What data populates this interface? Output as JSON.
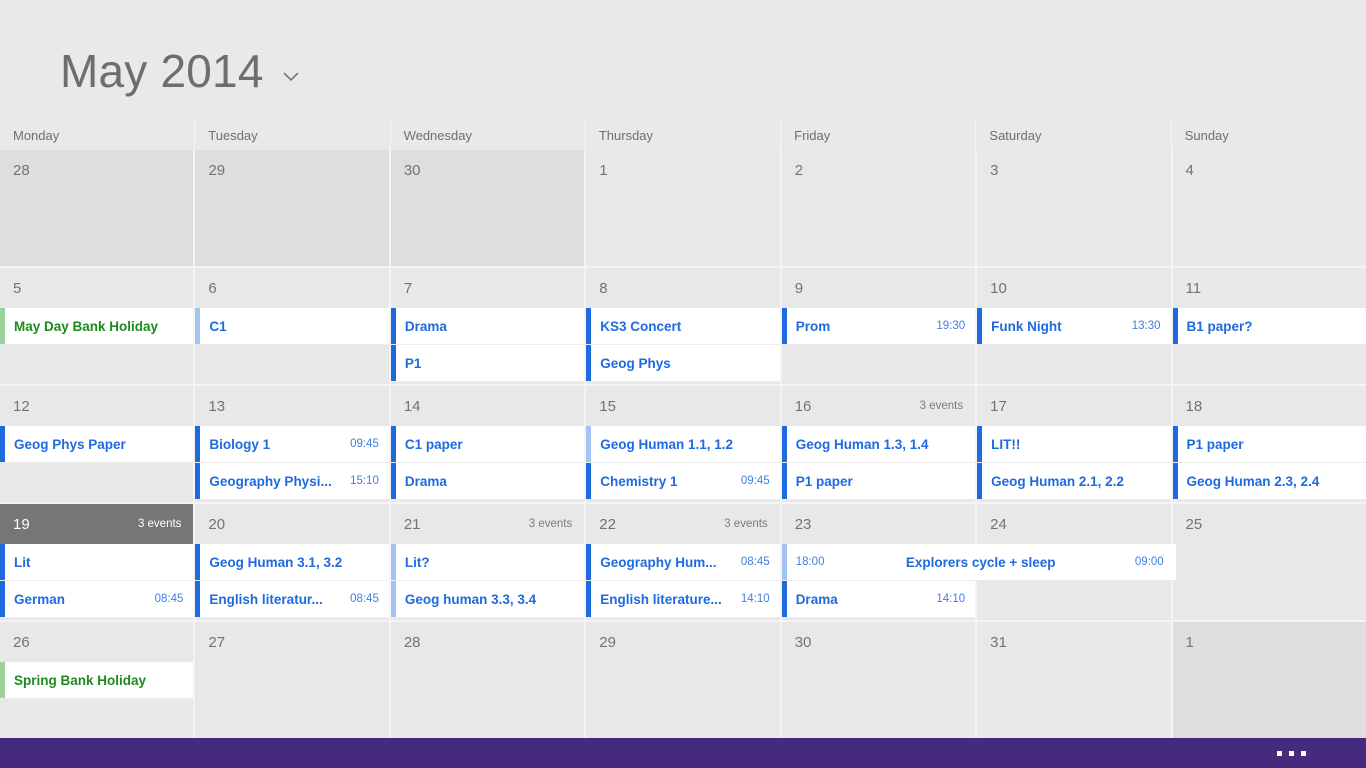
{
  "header": {
    "month_title": "May 2014",
    "dropdown_icon": "chevron-down-icon"
  },
  "weekdays": [
    "Monday",
    "Tuesday",
    "Wednesday",
    "Thursday",
    "Friday",
    "Saturday",
    "Sunday"
  ],
  "colors": {
    "accent_blue": "#1f6ae0",
    "accent_blue_light": "#a3c3f2",
    "accent_green": "#9bd19b",
    "holiday_text": "#1d8a1d",
    "selected_day_bg": "#767676",
    "appbar": "#452a7e",
    "cell_bg": "#e8e8e8",
    "cell_bg_other_month": "#dedede"
  },
  "appbar": {
    "menu_icon": "ellipsis-icon"
  },
  "weeks": [
    {
      "days": [
        {
          "num": "28",
          "other_month": true,
          "selected": false,
          "count": "",
          "events": []
        },
        {
          "num": "29",
          "other_month": true,
          "selected": false,
          "count": "",
          "events": []
        },
        {
          "num": "30",
          "other_month": true,
          "selected": false,
          "count": "",
          "events": []
        },
        {
          "num": "1",
          "other_month": false,
          "selected": false,
          "count": "",
          "events": []
        },
        {
          "num": "2",
          "other_month": false,
          "selected": false,
          "count": "",
          "events": []
        },
        {
          "num": "3",
          "other_month": false,
          "selected": false,
          "count": "",
          "events": []
        },
        {
          "num": "4",
          "other_month": false,
          "selected": false,
          "count": "",
          "events": []
        }
      ]
    },
    {
      "days": [
        {
          "num": "5",
          "other_month": false,
          "selected": false,
          "count": "",
          "events": [
            {
              "title": "May Day Bank Holiday",
              "time": "",
              "start": "",
              "accent": "green"
            }
          ]
        },
        {
          "num": "6",
          "other_month": false,
          "selected": false,
          "count": "",
          "events": [
            {
              "title": "C1",
              "time": "",
              "start": "",
              "accent": "light"
            }
          ]
        },
        {
          "num": "7",
          "other_month": false,
          "selected": false,
          "count": "",
          "events": [
            {
              "title": "Drama",
              "time": "",
              "start": "",
              "accent": "blue"
            },
            {
              "title": "P1",
              "time": "",
              "start": "",
              "accent": "blue"
            }
          ]
        },
        {
          "num": "8",
          "other_month": false,
          "selected": false,
          "count": "",
          "events": [
            {
              "title": "KS3 Concert",
              "time": "",
              "start": "",
              "accent": "blue"
            },
            {
              "title": "Geog Phys",
              "time": "",
              "start": "",
              "accent": "blue"
            }
          ]
        },
        {
          "num": "9",
          "other_month": false,
          "selected": false,
          "count": "",
          "events": [
            {
              "title": "Prom",
              "time": "19:30",
              "start": "",
              "accent": "blue"
            }
          ]
        },
        {
          "num": "10",
          "other_month": false,
          "selected": false,
          "count": "",
          "events": [
            {
              "title": "Funk Night",
              "time": "13:30",
              "start": "",
              "accent": "blue"
            }
          ]
        },
        {
          "num": "11",
          "other_month": false,
          "selected": false,
          "count": "",
          "events": [
            {
              "title": "B1 paper?",
              "time": "",
              "start": "",
              "accent": "blue"
            }
          ]
        }
      ]
    },
    {
      "days": [
        {
          "num": "12",
          "other_month": false,
          "selected": false,
          "count": "",
          "events": [
            {
              "title": "Geog Phys Paper",
              "time": "",
              "start": "",
              "accent": "blue"
            }
          ]
        },
        {
          "num": "13",
          "other_month": false,
          "selected": false,
          "count": "",
          "events": [
            {
              "title": "Biology 1",
              "time": "09:45",
              "start": "",
              "accent": "blue"
            },
            {
              "title": "Geography Physi...",
              "time": "15:10",
              "start": "",
              "accent": "blue"
            }
          ]
        },
        {
          "num": "14",
          "other_month": false,
          "selected": false,
          "count": "",
          "events": [
            {
              "title": "C1 paper",
              "time": "",
              "start": "",
              "accent": "blue"
            },
            {
              "title": "Drama",
              "time": "",
              "start": "",
              "accent": "blue"
            }
          ]
        },
        {
          "num": "15",
          "other_month": false,
          "selected": false,
          "count": "",
          "events": [
            {
              "title": "Geog Human 1.1, 1.2",
              "time": "",
              "start": "",
              "accent": "light"
            },
            {
              "title": "Chemistry 1",
              "time": "09:45",
              "start": "",
              "accent": "blue"
            }
          ]
        },
        {
          "num": "16",
          "other_month": false,
          "selected": false,
          "count": "3 events",
          "events": [
            {
              "title": "Geog Human 1.3, 1.4",
              "time": "",
              "start": "",
              "accent": "blue"
            },
            {
              "title": "P1 paper",
              "time": "",
              "start": "",
              "accent": "blue"
            }
          ]
        },
        {
          "num": "17",
          "other_month": false,
          "selected": false,
          "count": "",
          "events": [
            {
              "title": "LIT!!",
              "time": "",
              "start": "",
              "accent": "blue"
            },
            {
              "title": "Geog Human 2.1, 2.2",
              "time": "",
              "start": "",
              "accent": "blue"
            }
          ]
        },
        {
          "num": "18",
          "other_month": false,
          "selected": false,
          "count": "",
          "events": [
            {
              "title": "P1 paper",
              "time": "",
              "start": "",
              "accent": "blue"
            },
            {
              "title": "Geog Human 2.3, 2.4",
              "time": "",
              "start": "",
              "accent": "blue"
            }
          ]
        }
      ]
    },
    {
      "days": [
        {
          "num": "19",
          "other_month": false,
          "selected": true,
          "count": "3 events",
          "events": [
            {
              "title": "Lit",
              "time": "",
              "start": "",
              "accent": "blue"
            },
            {
              "title": "German",
              "time": "08:45",
              "start": "",
              "accent": "blue"
            }
          ]
        },
        {
          "num": "20",
          "other_month": false,
          "selected": false,
          "count": "",
          "events": [
            {
              "title": "Geog Human 3.1, 3.2",
              "time": "",
              "start": "",
              "accent": "blue"
            },
            {
              "title": "English literatur...",
              "time": "08:45",
              "start": "",
              "accent": "blue"
            }
          ]
        },
        {
          "num": "21",
          "other_month": false,
          "selected": false,
          "count": "3 events",
          "events": [
            {
              "title": "Lit?",
              "time": "",
              "start": "",
              "accent": "light"
            },
            {
              "title": "Geog human 3.3, 3.4",
              "time": "",
              "start": "",
              "accent": "light"
            }
          ]
        },
        {
          "num": "22",
          "other_month": false,
          "selected": false,
          "count": "3 events",
          "events": [
            {
              "title": "Geography Hum...",
              "time": "08:45",
              "start": "",
              "accent": "blue"
            },
            {
              "title": "English literature...",
              "time": "14:10",
              "start": "",
              "accent": "blue"
            }
          ]
        },
        {
          "num": "23",
          "other_month": false,
          "selected": false,
          "count": "",
          "events": [
            {
              "title": "Drama",
              "time": "14:10",
              "start": "",
              "accent": "blue",
              "row": 2
            }
          ],
          "span_event": {
            "title": "Explorers cycle + sleep",
            "start": "18:00",
            "time": "09:00",
            "accent": "light"
          }
        },
        {
          "num": "24",
          "other_month": false,
          "selected": false,
          "count": "",
          "events": []
        },
        {
          "num": "25",
          "other_month": false,
          "selected": false,
          "count": "",
          "events": []
        }
      ]
    },
    {
      "days": [
        {
          "num": "26",
          "other_month": false,
          "selected": false,
          "count": "",
          "events": [
            {
              "title": "Spring Bank Holiday",
              "time": "",
              "start": "",
              "accent": "green"
            }
          ]
        },
        {
          "num": "27",
          "other_month": false,
          "selected": false,
          "count": "",
          "events": []
        },
        {
          "num": "28",
          "other_month": false,
          "selected": false,
          "count": "",
          "events": []
        },
        {
          "num": "29",
          "other_month": false,
          "selected": false,
          "count": "",
          "events": []
        },
        {
          "num": "30",
          "other_month": false,
          "selected": false,
          "count": "",
          "events": []
        },
        {
          "num": "31",
          "other_month": false,
          "selected": false,
          "count": "",
          "events": []
        },
        {
          "num": "1",
          "other_month": true,
          "selected": false,
          "count": "",
          "events": []
        }
      ]
    }
  ]
}
